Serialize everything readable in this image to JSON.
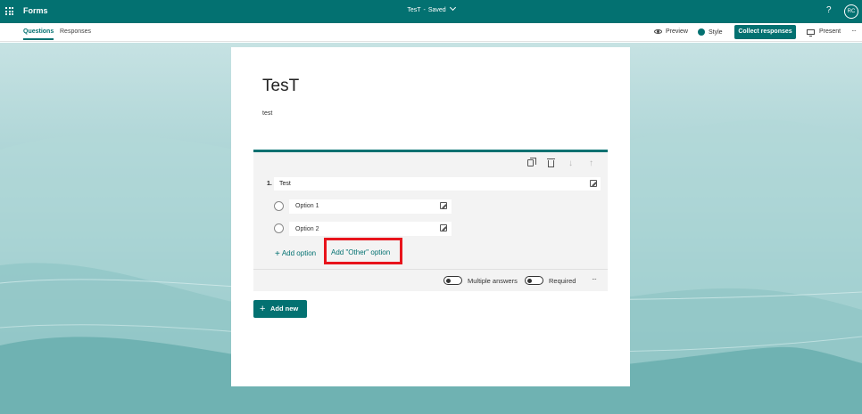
{
  "topbar": {
    "app_name": "Forms",
    "doc_title": "TesT",
    "separator": "-",
    "save_status": "Saved",
    "help": "?",
    "avatar_initials": "RC"
  },
  "nav": {
    "tabs": [
      {
        "label": "Questions",
        "active": true
      },
      {
        "label": "Responses",
        "active": false
      }
    ],
    "preview_label": "Preview",
    "style_label": "Style",
    "collect_label": "Collect responses",
    "present_label": "Present",
    "more": "···"
  },
  "form": {
    "title": "TesT",
    "description": "test"
  },
  "question": {
    "number": "1.",
    "text": "Test",
    "options": [
      {
        "label": "Option 1"
      },
      {
        "label": "Option 2"
      }
    ],
    "add_option_label": "Add option",
    "add_other_label": "Add \"Other\" option",
    "multiple_answers_label": "Multiple answers",
    "required_label": "Required",
    "more": "···"
  },
  "add_new_label": "Add new",
  "colors": {
    "brand": "#037171",
    "highlight": "#e8141c"
  }
}
